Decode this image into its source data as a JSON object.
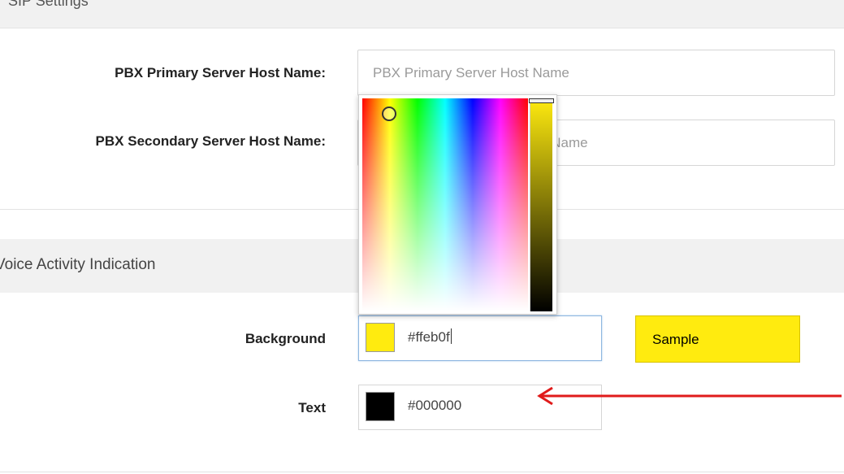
{
  "top_section": {
    "title": "SIP Settings"
  },
  "pbx": {
    "primary": {
      "label": "PBX Primary Server Host Name:",
      "placeholder": "PBX Primary Server Host Name"
    },
    "secondary": {
      "label": "PBX Secondary Server Host Name:",
      "placeholder": "PBX Secondary Server Host Name"
    }
  },
  "voice_activity": {
    "title": "Voice Activity Indication",
    "background": {
      "label": "Background",
      "value": "#ffeb0f",
      "swatch": "#ffeb0f"
    },
    "text": {
      "label": "Text",
      "value": "#000000",
      "swatch": "#000000"
    },
    "sample": {
      "label": "Sample",
      "bg": "#ffeb0f",
      "fg": "#000000"
    }
  },
  "color_picker": {
    "brightness_color": "#ffeb0f"
  },
  "colors": {
    "annotation_arrow": "#e01b1b",
    "focus_border": "#8db6e0",
    "section_bg": "#f1f1f1"
  }
}
